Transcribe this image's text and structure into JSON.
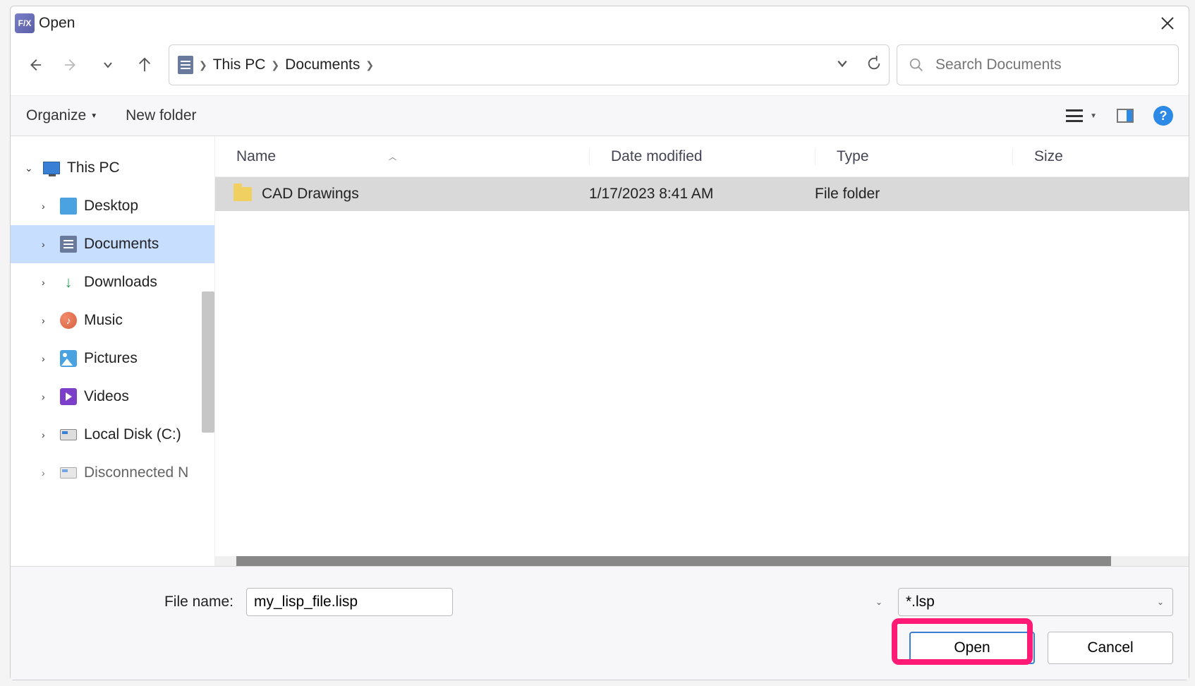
{
  "window": {
    "title": "Open"
  },
  "breadcrumb": {
    "root": "This PC",
    "current": "Documents"
  },
  "search": {
    "placeholder": "Search Documents"
  },
  "toolbar": {
    "organize": "Organize",
    "newfolder": "New folder"
  },
  "sidebar": {
    "root": "This PC",
    "items": [
      {
        "label": "Desktop"
      },
      {
        "label": "Documents"
      },
      {
        "label": "Downloads"
      },
      {
        "label": "Music"
      },
      {
        "label": "Pictures"
      },
      {
        "label": "Videos"
      },
      {
        "label": "Local Disk (C:)"
      },
      {
        "label": "Disconnected N"
      }
    ]
  },
  "columns": {
    "name": "Name",
    "date": "Date modified",
    "type": "Type",
    "size": "Size"
  },
  "files": [
    {
      "name": "CAD Drawings",
      "date": "1/17/2023 8:41 AM",
      "type": "File folder"
    }
  ],
  "footer": {
    "fname_label": "File name:",
    "fname_value": "my_lisp_file.lisp",
    "filter": "*.lsp",
    "open": "Open",
    "cancel": "Cancel"
  }
}
